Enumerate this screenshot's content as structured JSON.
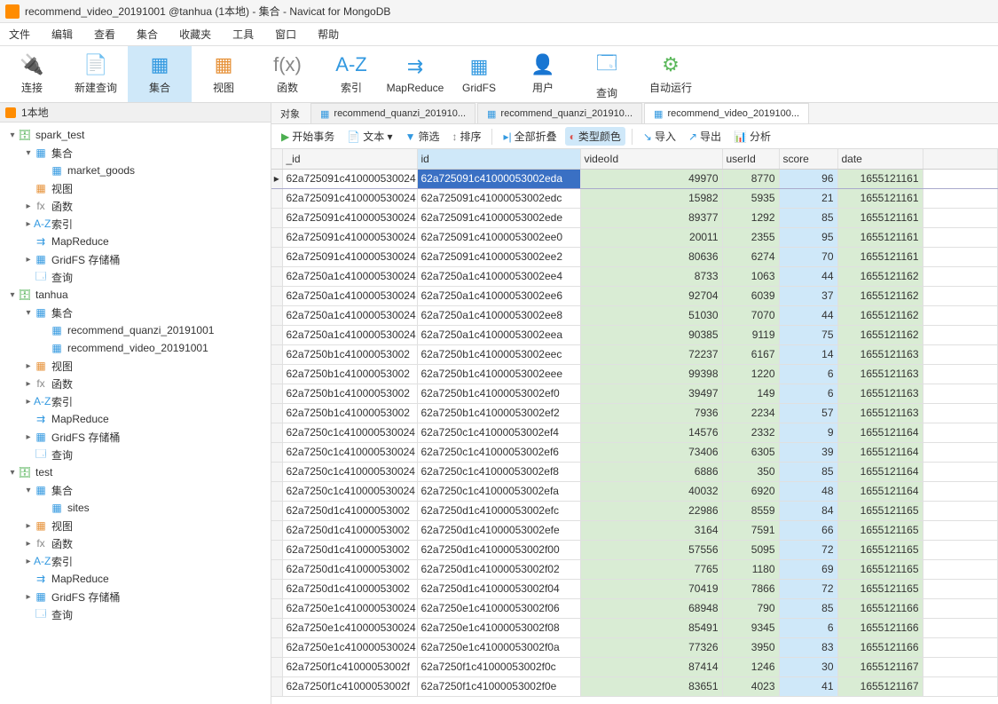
{
  "title": "recommend_video_20191001 @tanhua (1本地) - 集合 - Navicat for MongoDB",
  "menu": [
    "文件",
    "编辑",
    "查看",
    "集合",
    "收藏夹",
    "工具",
    "窗口",
    "帮助"
  ],
  "toolbar": [
    {
      "label": "连接",
      "icon": "🔌",
      "cls": "orange"
    },
    {
      "label": "新建查询",
      "icon": "📄",
      "cls": ""
    },
    {
      "label": "集合",
      "icon": "▦",
      "cls": "",
      "active": true
    },
    {
      "label": "视图",
      "icon": "▦",
      "cls": "orange"
    },
    {
      "label": "函数",
      "icon": "f(x)",
      "cls": "gray"
    },
    {
      "label": "索引",
      "icon": "A-Z",
      "cls": ""
    },
    {
      "label": "MapReduce",
      "icon": "⇉",
      "cls": ""
    },
    {
      "label": "GridFS",
      "icon": "▦",
      "cls": ""
    },
    {
      "label": "用户",
      "icon": "👤",
      "cls": "orange"
    },
    {
      "label": "查询",
      "icon": "🗔",
      "cls": ""
    },
    {
      "label": "自动运行",
      "icon": "⚙",
      "cls": "green"
    }
  ],
  "connection_tab": "1本地",
  "tree": [
    {
      "ind": 0,
      "tog": "▾",
      "ico": "🗄",
      "col": "#4caf50",
      "txt": "spark_test"
    },
    {
      "ind": 1,
      "tog": "▾",
      "ico": "▦",
      "col": "#3399e0",
      "txt": "集合"
    },
    {
      "ind": 2,
      "tog": "",
      "ico": "▦",
      "col": "#3399e0",
      "txt": "market_goods"
    },
    {
      "ind": 1,
      "tog": "",
      "ico": "▦",
      "col": "#e69138",
      "txt": "视图"
    },
    {
      "ind": 1,
      "tog": "▸",
      "ico": "fx",
      "col": "#888",
      "txt": "函数"
    },
    {
      "ind": 1,
      "tog": "▸",
      "ico": "A-Z",
      "col": "#3399e0",
      "txt": "索引"
    },
    {
      "ind": 1,
      "tog": "",
      "ico": "⇉",
      "col": "#3399e0",
      "txt": "MapReduce"
    },
    {
      "ind": 1,
      "tog": "▸",
      "ico": "▦",
      "col": "#3399e0",
      "txt": "GridFS 存储桶"
    },
    {
      "ind": 1,
      "tog": "",
      "ico": "🗔",
      "col": "#3399e0",
      "txt": "查询"
    },
    {
      "ind": 0,
      "tog": "▾",
      "ico": "🗄",
      "col": "#4caf50",
      "txt": "tanhua"
    },
    {
      "ind": 1,
      "tog": "▾",
      "ico": "▦",
      "col": "#3399e0",
      "txt": "集合"
    },
    {
      "ind": 2,
      "tog": "",
      "ico": "▦",
      "col": "#3399e0",
      "txt": "recommend_quanzi_20191001"
    },
    {
      "ind": 2,
      "tog": "",
      "ico": "▦",
      "col": "#3399e0",
      "txt": "recommend_video_20191001"
    },
    {
      "ind": 1,
      "tog": "▸",
      "ico": "▦",
      "col": "#e69138",
      "txt": "视图"
    },
    {
      "ind": 1,
      "tog": "▸",
      "ico": "fx",
      "col": "#888",
      "txt": "函数"
    },
    {
      "ind": 1,
      "tog": "▸",
      "ico": "A-Z",
      "col": "#3399e0",
      "txt": "索引"
    },
    {
      "ind": 1,
      "tog": "",
      "ico": "⇉",
      "col": "#3399e0",
      "txt": "MapReduce"
    },
    {
      "ind": 1,
      "tog": "▸",
      "ico": "▦",
      "col": "#3399e0",
      "txt": "GridFS 存储桶"
    },
    {
      "ind": 1,
      "tog": "",
      "ico": "🗔",
      "col": "#3399e0",
      "txt": "查询"
    },
    {
      "ind": 0,
      "tog": "▾",
      "ico": "🗄",
      "col": "#4caf50",
      "txt": "test"
    },
    {
      "ind": 1,
      "tog": "▾",
      "ico": "▦",
      "col": "#3399e0",
      "txt": "集合"
    },
    {
      "ind": 2,
      "tog": "",
      "ico": "▦",
      "col": "#3399e0",
      "txt": "sites"
    },
    {
      "ind": 1,
      "tog": "▸",
      "ico": "▦",
      "col": "#e69138",
      "txt": "视图"
    },
    {
      "ind": 1,
      "tog": "▸",
      "ico": "fx",
      "col": "#888",
      "txt": "函数"
    },
    {
      "ind": 1,
      "tog": "▸",
      "ico": "A-Z",
      "col": "#3399e0",
      "txt": "索引"
    },
    {
      "ind": 1,
      "tog": "",
      "ico": "⇉",
      "col": "#3399e0",
      "txt": "MapReduce"
    },
    {
      "ind": 1,
      "tog": "▸",
      "ico": "▦",
      "col": "#3399e0",
      "txt": "GridFS 存储桶"
    },
    {
      "ind": 1,
      "tog": "",
      "ico": "🗔",
      "col": "#3399e0",
      "txt": "查询"
    }
  ],
  "tabs": [
    {
      "label": "对象",
      "obj": true
    },
    {
      "label": "recommend_quanzi_201910..."
    },
    {
      "label": "recommend_quanzi_201910..."
    },
    {
      "label": "recommend_video_2019100...",
      "active": true
    }
  ],
  "tooltab": [
    {
      "ico": "▶",
      "txt": "开始事务",
      "col": "#4caf50"
    },
    {
      "ico": "📄",
      "txt": "文本 ▾",
      "col": "#888"
    },
    {
      "ico": "▼",
      "txt": "筛选",
      "col": "#3399e0"
    },
    {
      "ico": "↕",
      "txt": "排序",
      "col": "#888"
    },
    {
      "sep": true
    },
    {
      "ico": "▸|",
      "txt": "全部折叠",
      "col": "#3399e0"
    },
    {
      "ico": "◐",
      "txt": "类型颜色",
      "col": "#d9534f",
      "active": true
    },
    {
      "sep": true
    },
    {
      "ico": "↘",
      "txt": "导入",
      "col": "#3399e0"
    },
    {
      "ico": "↗",
      "txt": "导出",
      "col": "#3399e0"
    },
    {
      "ico": "📊",
      "txt": "分析",
      "col": "#e69138"
    }
  ],
  "columns": [
    "_id",
    "id",
    "videoId",
    "userId",
    "score",
    "date"
  ],
  "rows": [
    [
      "62a725091c410000530024",
      "62a725091c41000053002eda",
      49970,
      8770,
      96,
      1655121161
    ],
    [
      "62a725091c410000530024",
      "62a725091c41000053002edc",
      15982,
      5935,
      21,
      1655121161
    ],
    [
      "62a725091c410000530024",
      "62a725091c41000053002ede",
      89377,
      1292,
      85,
      1655121161
    ],
    [
      "62a725091c410000530024",
      "62a725091c41000053002ee0",
      20011,
      2355,
      95,
      1655121161
    ],
    [
      "62a725091c410000530024",
      "62a725091c41000053002ee2",
      80636,
      6274,
      70,
      1655121161
    ],
    [
      "62a7250a1c410000530024",
      "62a7250a1c41000053002ee4",
      8733,
      1063,
      44,
      1655121162
    ],
    [
      "62a7250a1c410000530024",
      "62a7250a1c41000053002ee6",
      92704,
      6039,
      37,
      1655121162
    ],
    [
      "62a7250a1c410000530024",
      "62a7250a1c41000053002ee8",
      51030,
      7070,
      44,
      1655121162
    ],
    [
      "62a7250a1c410000530024",
      "62a7250a1c41000053002eea",
      90385,
      9119,
      75,
      1655121162
    ],
    [
      "62a7250b1c41000053002",
      "62a7250b1c41000053002eec",
      72237,
      6167,
      14,
      1655121163
    ],
    [
      "62a7250b1c41000053002",
      "62a7250b1c41000053002eee",
      99398,
      1220,
      6,
      1655121163
    ],
    [
      "62a7250b1c41000053002",
      "62a7250b1c41000053002ef0",
      39497,
      149,
      6,
      1655121163
    ],
    [
      "62a7250b1c41000053002",
      "62a7250b1c41000053002ef2",
      7936,
      2234,
      57,
      1655121163
    ],
    [
      "62a7250c1c410000530024",
      "62a7250c1c41000053002ef4",
      14576,
      2332,
      9,
      1655121164
    ],
    [
      "62a7250c1c410000530024",
      "62a7250c1c41000053002ef6",
      73406,
      6305,
      39,
      1655121164
    ],
    [
      "62a7250c1c410000530024",
      "62a7250c1c41000053002ef8",
      6886,
      350,
      85,
      1655121164
    ],
    [
      "62a7250c1c410000530024",
      "62a7250c1c41000053002efa",
      40032,
      6920,
      48,
      1655121164
    ],
    [
      "62a7250d1c41000053002",
      "62a7250d1c41000053002efc",
      22986,
      8559,
      84,
      1655121165
    ],
    [
      "62a7250d1c41000053002",
      "62a7250d1c41000053002efe",
      3164,
      7591,
      66,
      1655121165
    ],
    [
      "62a7250d1c41000053002",
      "62a7250d1c41000053002f00",
      57556,
      5095,
      72,
      1655121165
    ],
    [
      "62a7250d1c41000053002",
      "62a7250d1c41000053002f02",
      7765,
      1180,
      69,
      1655121165
    ],
    [
      "62a7250d1c41000053002",
      "62a7250d1c41000053002f04",
      70419,
      7866,
      72,
      1655121165
    ],
    [
      "62a7250e1c410000530024",
      "62a7250e1c41000053002f06",
      68948,
      790,
      85,
      1655121166
    ],
    [
      "62a7250e1c410000530024",
      "62a7250e1c41000053002f08",
      85491,
      9345,
      6,
      1655121166
    ],
    [
      "62a7250e1c410000530024",
      "62a7250e1c41000053002f0a",
      77326,
      3950,
      83,
      1655121166
    ],
    [
      "62a7250f1c41000053002f",
      "62a7250f1c41000053002f0c",
      87414,
      1246,
      30,
      1655121167
    ],
    [
      "62a7250f1c41000053002f",
      "62a7250f1c41000053002f0e",
      83651,
      4023,
      41,
      1655121167
    ]
  ]
}
